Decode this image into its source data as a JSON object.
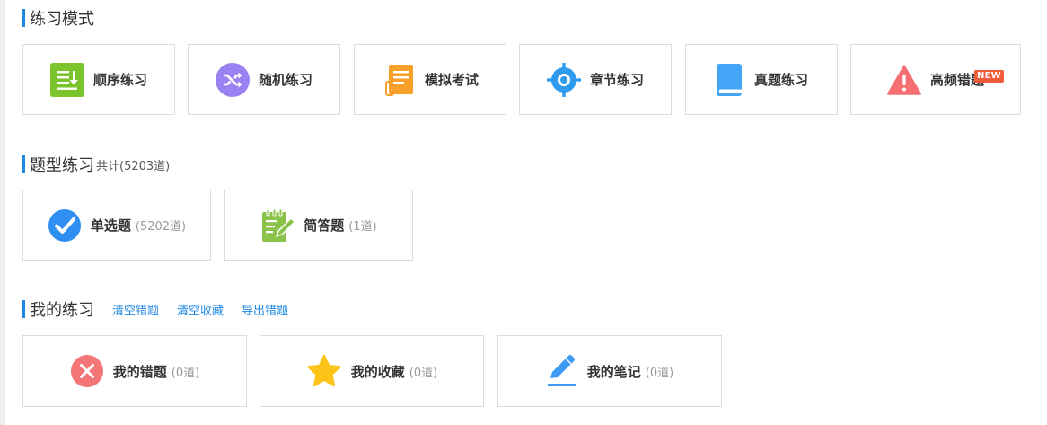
{
  "practice_modes": {
    "title": "练习模式",
    "items": [
      {
        "label": "顺序练习",
        "icon": "list-download-icon",
        "color": "#7cc42b"
      },
      {
        "label": "随机练习",
        "icon": "shuffle-icon",
        "color": "#9b82f3"
      },
      {
        "label": "模拟考试",
        "icon": "exam-paper-icon",
        "color": "#f7a12a"
      },
      {
        "label": "章节练习",
        "icon": "target-icon",
        "color": "#2f9bee"
      },
      {
        "label": "真题练习",
        "icon": "book-icon",
        "color": "#42a5f5"
      },
      {
        "label": "高频错题",
        "icon": "warning-icon",
        "color": "#f46e73",
        "badge": "NEW"
      }
    ]
  },
  "question_types": {
    "title": "题型练习",
    "subtitle": "共计(5203道)",
    "items": [
      {
        "label": "单选题",
        "count": "(5202道)",
        "icon": "check-circle-icon",
        "color": "#2f8ef2"
      },
      {
        "label": "简答题",
        "count": "(1道)",
        "icon": "notepad-pen-icon",
        "color": "#8bc34a"
      }
    ]
  },
  "my_practice": {
    "title": "我的练习",
    "links": [
      "清空错题",
      "清空收藏",
      "导出错题"
    ],
    "items": [
      {
        "label": "我的错题",
        "count": "(0道)",
        "icon": "close-circle-icon",
        "color": "#f47575"
      },
      {
        "label": "我的收藏",
        "count": "(0道)",
        "icon": "star-icon",
        "color": "#fcc419"
      },
      {
        "label": "我的笔记",
        "count": "(0道)",
        "icon": "pen-icon",
        "color": "#3d9bf3"
      }
    ]
  }
}
